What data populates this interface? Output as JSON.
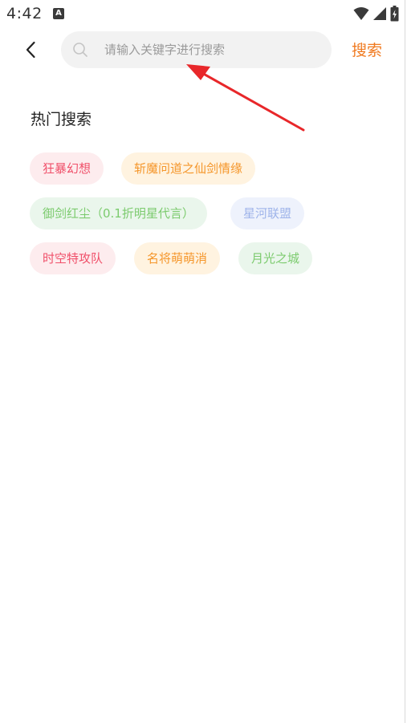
{
  "status_bar": {
    "time": "4:42",
    "a_icon_letter": "A"
  },
  "header": {
    "search_placeholder": "请输入关键字进行搜索",
    "search_value": "",
    "search_button_label": "搜索"
  },
  "hot_search": {
    "title": "热门搜索",
    "tags": [
      {
        "label": "狂暴幻想",
        "color": "red"
      },
      {
        "label": "斩魔问道之仙剑情缘",
        "color": "orange"
      },
      {
        "label": "御剑红尘（0.1折明星代言）",
        "color": "green"
      },
      {
        "label": "星河联盟",
        "color": "blue"
      },
      {
        "label": "时空特攻队",
        "color": "red"
      },
      {
        "label": "名将萌萌消",
        "color": "orange"
      },
      {
        "label": "月光之城",
        "color": "green"
      }
    ]
  },
  "colors": {
    "accent": "#f07a20",
    "annotation_arrow": "#e8272a"
  }
}
